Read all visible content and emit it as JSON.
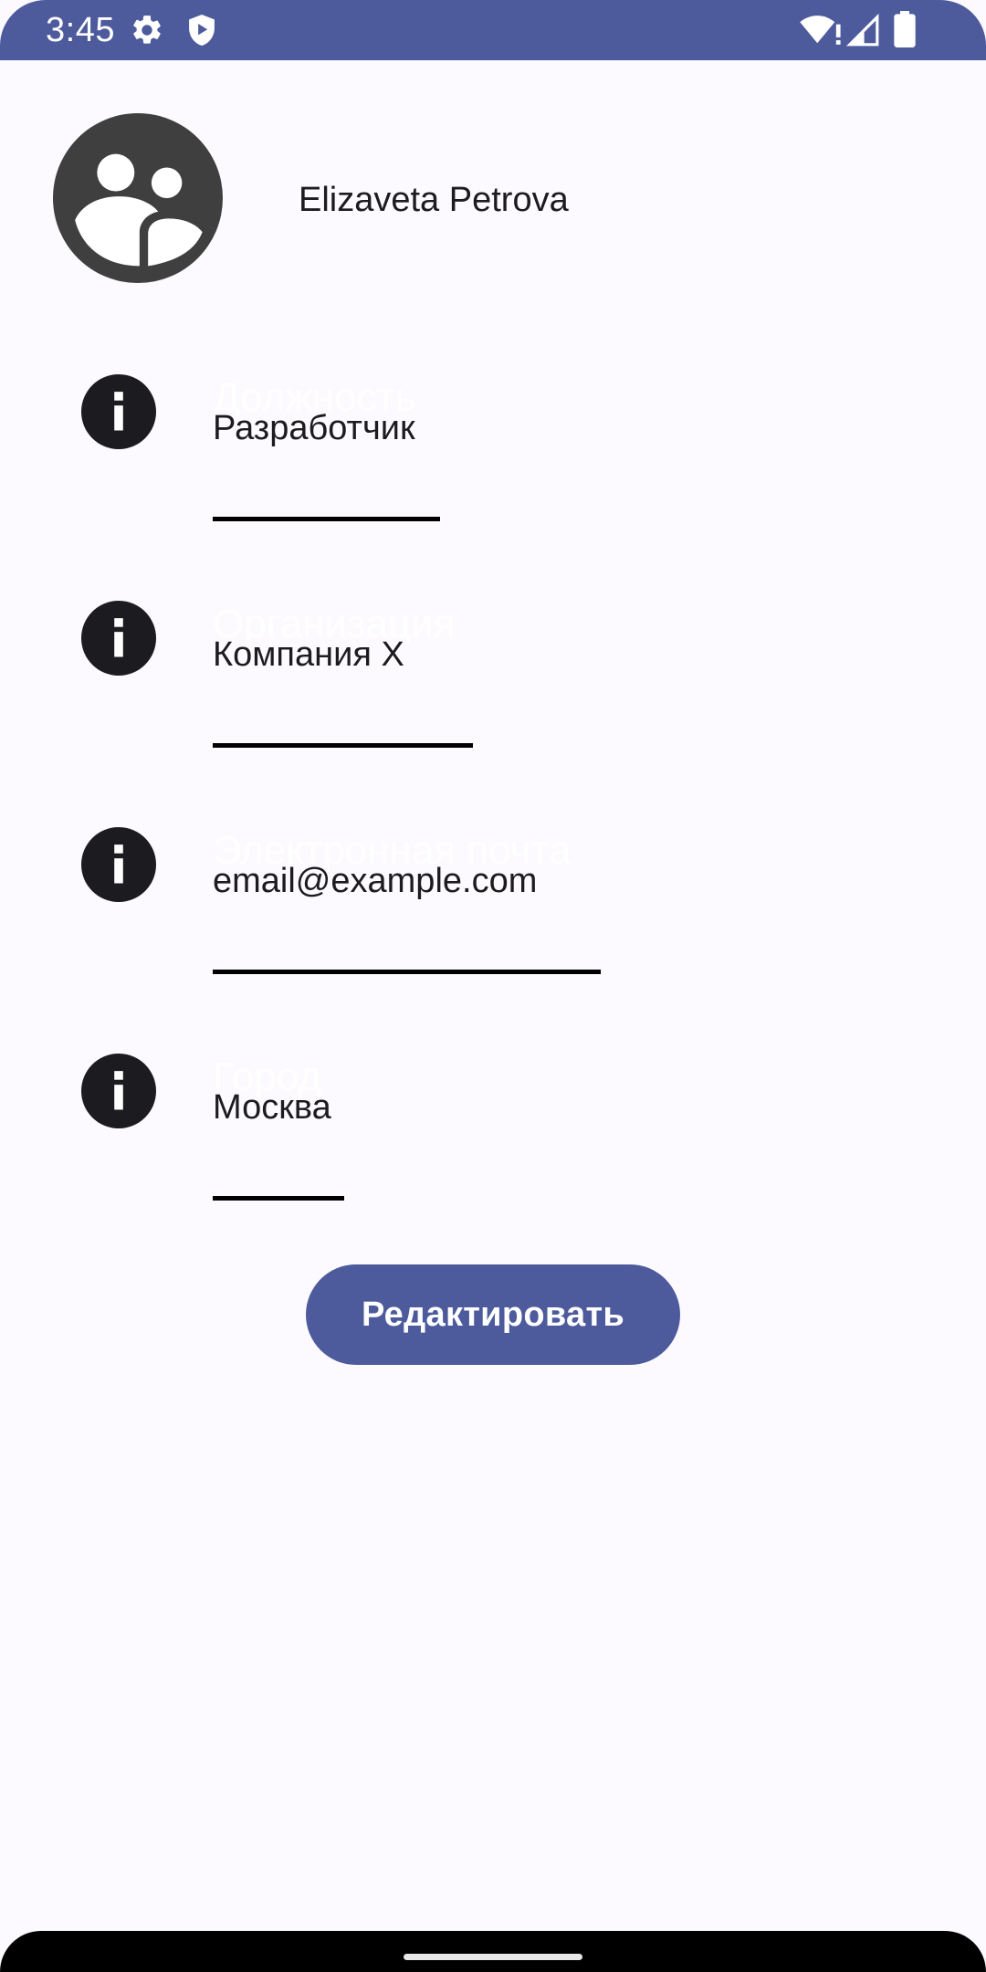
{
  "status_bar": {
    "time": "3:45",
    "icons": [
      "gear-icon",
      "shield-play-icon",
      "wifi-alert-icon",
      "cellular-signal-icon",
      "battery-icon"
    ]
  },
  "profile": {
    "name": "Elizaveta Petrova",
    "avatar_icon": "group-avatar-icon"
  },
  "fields": [
    {
      "label": "Должность",
      "value": "Разработчик",
      "icon": "info-icon"
    },
    {
      "label": "Организация",
      "value": "Компания X",
      "icon": "info-icon"
    },
    {
      "label": "Электронная почта",
      "value": "email@example.com",
      "icon": "info-icon"
    },
    {
      "label": "Город",
      "value": "Москва",
      "icon": "info-icon"
    }
  ],
  "actions": {
    "edit_label": "Редактировать"
  },
  "colors": {
    "primary": "#4d5b9c",
    "background": "#fcfaff",
    "text": "#1c1b1f",
    "icon": "#1c1b1f"
  }
}
